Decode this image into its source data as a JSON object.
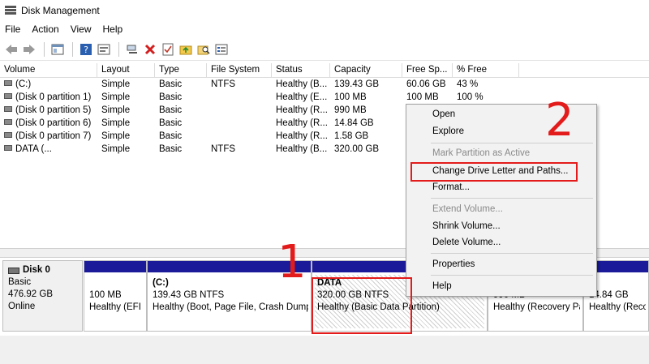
{
  "window": {
    "title": "Disk Management"
  },
  "menu": [
    "File",
    "Action",
    "View",
    "Help"
  ],
  "toolbar": {
    "icons": [
      "back-arrow-icon",
      "forward-arrow-icon",
      "console-tree-icon",
      "help-icon",
      "properties-icon",
      "connect-icon",
      "delete-icon",
      "checklist-icon",
      "folder-up-icon",
      "search-folder-icon",
      "settings-list-icon"
    ]
  },
  "table": {
    "headers": [
      "Volume",
      "Layout",
      "Type",
      "File System",
      "Status",
      "Capacity",
      "Free Sp...",
      "% Free"
    ],
    "rows": [
      [
        "(C:)",
        "Simple",
        "Basic",
        "NTFS",
        "Healthy (B...",
        "139.43 GB",
        "60.06 GB",
        "43 %"
      ],
      [
        "(Disk 0 partition 1)",
        "Simple",
        "Basic",
        "",
        "Healthy (E...",
        "100 MB",
        "100 MB",
        "100 %"
      ],
      [
        "(Disk 0 partition 5)",
        "Simple",
        "Basic",
        "",
        "Healthy (R...",
        "990 MB",
        "",
        ""
      ],
      [
        "(Disk 0 partition 6)",
        "Simple",
        "Basic",
        "",
        "Healthy (R...",
        "14.84 GB",
        "",
        ""
      ],
      [
        "(Disk 0 partition 7)",
        "Simple",
        "Basic",
        "",
        "Healthy (R...",
        "1.58 GB",
        "",
        ""
      ],
      [
        "DATA (...",
        "Simple",
        "Basic",
        "NTFS",
        "Healthy (B...",
        "320.00 GB",
        "",
        ""
      ]
    ]
  },
  "disk": {
    "name": "Disk 0",
    "type": "Basic",
    "size": "476.92 GB",
    "state": "Online",
    "partitions": [
      {
        "name": "",
        "size": "100 MB",
        "status": "Healthy (EFI S"
      },
      {
        "name": "(C:)",
        "size": "139.43 GB NTFS",
        "status": "Healthy (Boot, Page File, Crash Dump,"
      },
      {
        "name": "DATA",
        "size": "320.00 GB NTFS",
        "status": "Healthy (Basic Data Partition)"
      },
      {
        "name": "",
        "size": "990 MB",
        "status": "Healthy (Recovery Pa"
      },
      {
        "name": "",
        "size": "14.84 GB",
        "status": "Healthy (Recove"
      }
    ]
  },
  "context_menu": {
    "items": [
      {
        "label": "Open",
        "enabled": true
      },
      {
        "label": "Explore",
        "enabled": true
      },
      {
        "label": "Mark Partition as Active",
        "enabled": false
      },
      {
        "label": "Change Drive Letter and Paths...",
        "enabled": true
      },
      {
        "label": "Format...",
        "enabled": true
      },
      {
        "label": "Extend Volume...",
        "enabled": false
      },
      {
        "label": "Shrink Volume...",
        "enabled": true
      },
      {
        "label": "Delete Volume...",
        "enabled": true
      },
      {
        "label": "Properties",
        "enabled": true
      },
      {
        "label": "Help",
        "enabled": true
      }
    ]
  },
  "annotations": {
    "step1": "1",
    "step2": "2",
    "color": "#e31b1b"
  },
  "colors": {
    "partition_bar": "#1b1b9a",
    "highlight": "#e31b1b"
  }
}
